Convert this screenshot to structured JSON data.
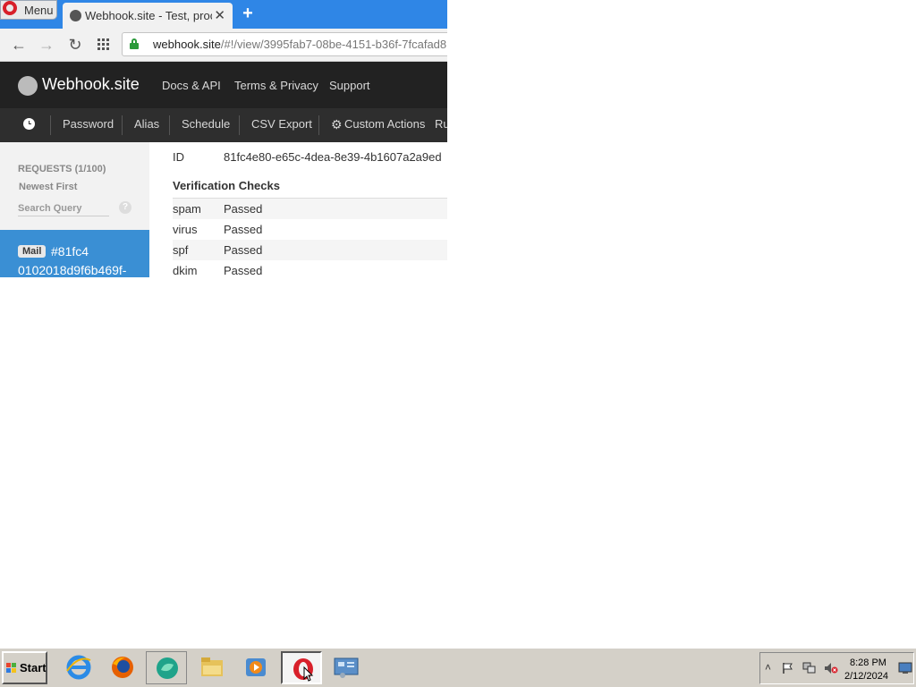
{
  "browser": {
    "menu_label": "Menu",
    "tab_title": "Webhook.site - Test, process and transform emails and HTTP requests",
    "tab_close": "✕",
    "new_tab": "+",
    "url_host": "webhook.site",
    "url_path": "/#!/view/3995fab7-08be-4151-b36f-7fcafad8",
    "icons": [
      "back-icon",
      "forward-icon",
      "reload-icon",
      "speed-dial-icon",
      "lock-icon"
    ]
  },
  "site": {
    "logo_text": "Webhook.site",
    "nav": [
      "Docs & API",
      "Terms & Privacy",
      "Support"
    ],
    "subnav": [
      "Password",
      "Alias",
      "Schedule",
      "CSV Export",
      "Custom Actions",
      "Ru"
    ]
  },
  "sidebar": {
    "requests_label": "REQUESTS (1/100)",
    "sort_label": "Newest First",
    "search_placeholder": "Search Query",
    "help": "?",
    "item": {
      "badge": "Mail",
      "id_line1": "#81fc4",
      "id_line2": "0102018d9f6b469f-"
    }
  },
  "main": {
    "id_label": "ID",
    "id_value": "81fc4e80-e65c-4dea-8e39-4b1607a2a9ed",
    "checks_title": "Verification Checks",
    "checks": [
      {
        "name": "spam",
        "result": "Passed"
      },
      {
        "name": "virus",
        "result": "Passed"
      },
      {
        "name": "spf",
        "result": "Passed"
      },
      {
        "name": "dkim",
        "result": "Passed"
      }
    ]
  },
  "taskbar": {
    "start_label": "Start",
    "apps": [
      "internet-explorer-icon",
      "firefox-icon",
      "edge-icon",
      "file-explorer-icon",
      "media-player-icon",
      "opera-icon",
      "control-panel-icon"
    ],
    "time": "8:28 PM",
    "date": "2/12/2024"
  },
  "colors": {
    "tab_strip": "#2f86e6",
    "site_header": "#222222",
    "selected_request": "#3a8fd4"
  }
}
